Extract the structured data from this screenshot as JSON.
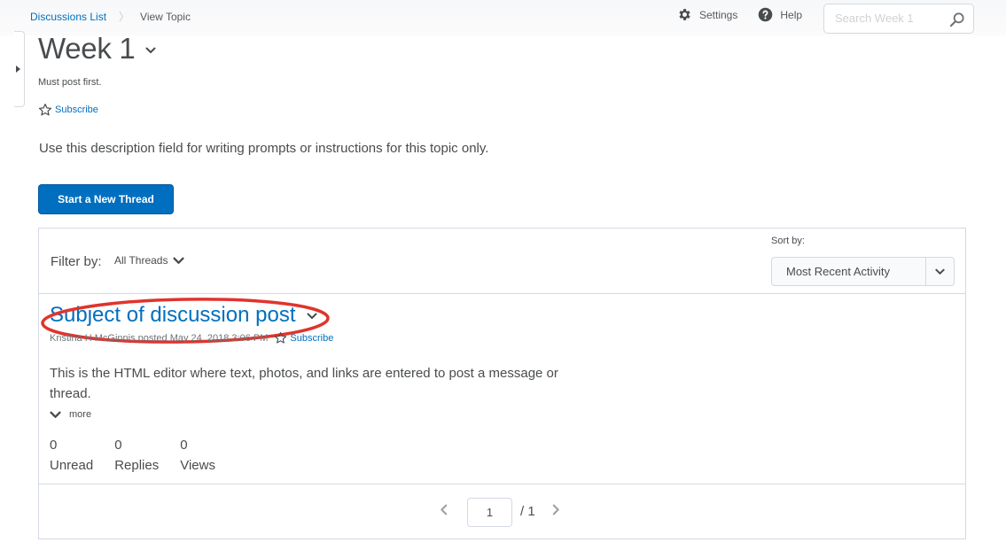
{
  "breadcrumb": {
    "items": [
      "Discussions List",
      "View Topic"
    ]
  },
  "nav": {
    "settings_label": "Settings",
    "help_label": "Help",
    "search_placeholder": "Search Week 1"
  },
  "topic": {
    "title": "Week 1",
    "note": "Must post first.",
    "subscribe_label": "Subscribe",
    "description": "Use this description field for writing prompts or instructions for this topic only."
  },
  "actions": {
    "new_thread_label": "Start a New Thread"
  },
  "filter": {
    "label": "Filter by:",
    "value": "All Threads",
    "sort_label": "Sort by:",
    "sort_value": "Most Recent Activity"
  },
  "thread": {
    "title": "Subject of discussion post",
    "meta": "Kristina H McGinnis posted May 24, 2018 3:06 PM",
    "subscribe_label": "Subscribe",
    "body": "This is the HTML editor where text, photos, and links are entered to post a message or thread.",
    "more_label": "more",
    "stats": [
      {
        "value": "0",
        "label": "Unread"
      },
      {
        "value": "0",
        "label": "Replies"
      },
      {
        "value": "0",
        "label": "Views"
      }
    ]
  },
  "pager": {
    "current": "1",
    "total": "/ 1"
  },
  "colors": {
    "link": "#006fbf",
    "primary": "#006fbf",
    "highlight": "#e0342c"
  }
}
